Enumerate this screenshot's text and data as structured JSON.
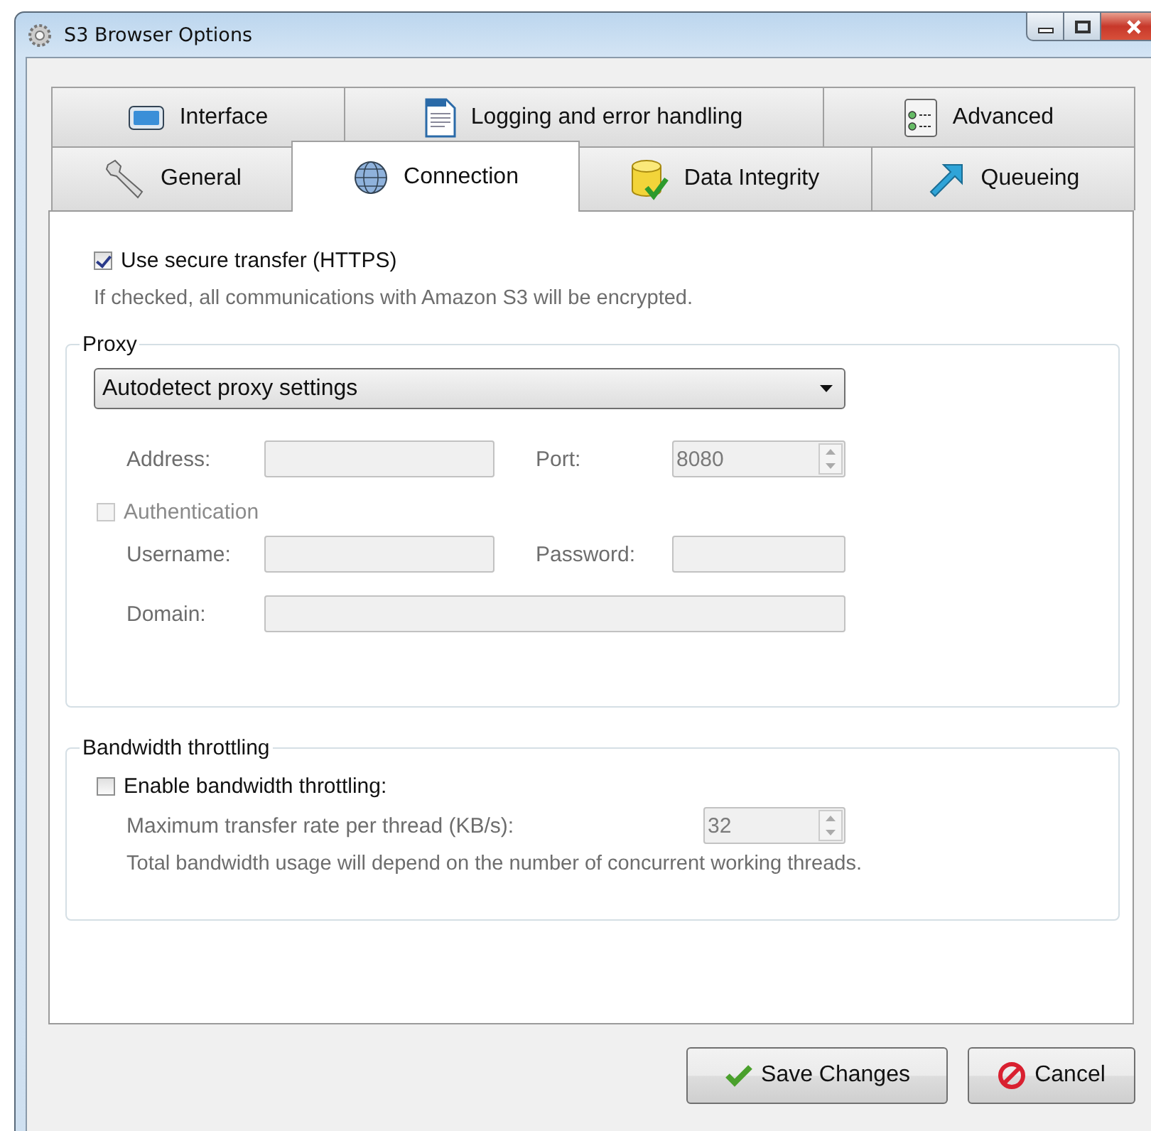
{
  "window": {
    "title": "S3 Browser Options"
  },
  "tab_rows": [
    [
      {
        "label": "Interface",
        "selected": false
      },
      {
        "label": "Logging and error handling",
        "selected": false
      },
      {
        "label": "Advanced",
        "selected": false
      }
    ],
    [
      {
        "label": "General",
        "selected": false
      },
      {
        "label": "Connection",
        "selected": true
      },
      {
        "label": "Data Integrity",
        "selected": false
      },
      {
        "label": "Queueing",
        "selected": false
      }
    ]
  ],
  "secure_transfer": {
    "label": "Use secure transfer (HTTPS)",
    "checked": true,
    "hint": "If checked, all communications with Amazon S3 will be encrypted."
  },
  "proxy": {
    "title": "Proxy",
    "mode": "Autodetect proxy settings",
    "address": {
      "label": "Address:",
      "disabled": true
    },
    "port": {
      "label": "Port:",
      "value": "8080",
      "disabled": true
    },
    "authentication": {
      "label": "Authentication",
      "checked": false,
      "disabled": true
    },
    "username": {
      "label": "Username:",
      "disabled": true
    },
    "password": {
      "label": "Password:",
      "disabled": true
    },
    "domain": {
      "label": "Domain:",
      "disabled": true
    }
  },
  "bandwidth": {
    "title": "Bandwidth throttling",
    "enable": {
      "label": "Enable bandwidth throttling:",
      "checked": false
    },
    "max_rate": {
      "label": "Maximum transfer rate per thread (KB/s):",
      "value": "32",
      "disabled": true
    },
    "hint": "Total bandwidth usage will depend on the number of concurrent working threads."
  },
  "buttons": [
    {
      "kind": "save",
      "label": "Save Changes"
    },
    {
      "kind": "cancel",
      "label": "Cancel"
    }
  ]
}
